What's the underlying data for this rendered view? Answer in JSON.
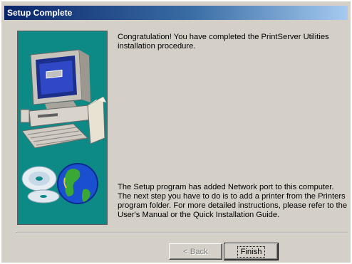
{
  "window": {
    "title": "Setup Complete"
  },
  "content": {
    "message_top": "Congratulation! You have completed the PrintServer Utilities installation procedure.",
    "message_bottom": "The Setup program has added Network port to this computer. The next step you have to do is to add a printer from the Printers program folder. For more detailed instructions, please refer to the User's Manual or the Quick Installation Guide."
  },
  "buttons": {
    "back_label": "< Back",
    "finish_label": "Finish"
  },
  "colors": {
    "titlebar_start": "#0a246a",
    "titlebar_end": "#a6caf0",
    "dialog_bg": "#d4d0c8",
    "art_bg": "#0d8a86"
  },
  "icons": {
    "art": "computer-cd-globe-illustration"
  }
}
